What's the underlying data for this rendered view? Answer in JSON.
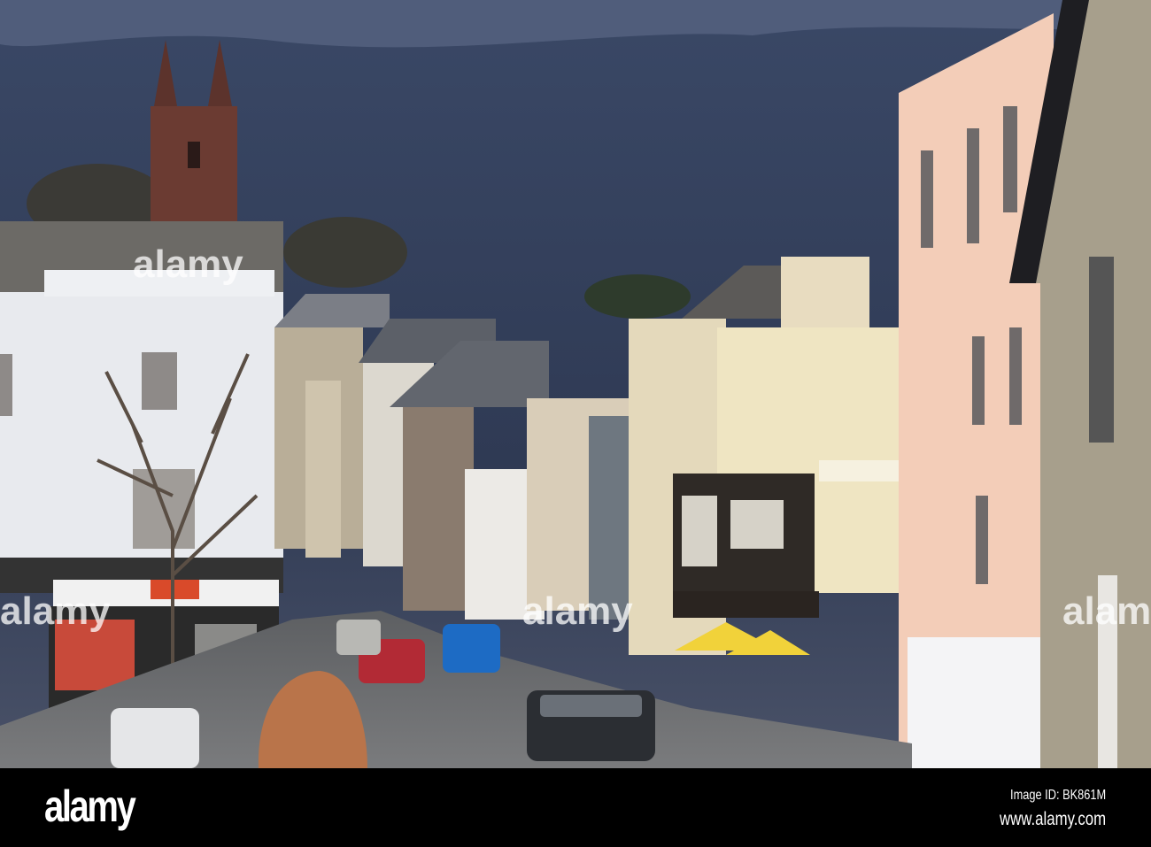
{
  "photo": {
    "subject": "Town high street with shops, cars and church tower under stormy sky"
  },
  "watermark": {
    "text": "alamy"
  },
  "footer": {
    "logo": "alamy",
    "image_id": "Image ID: BK861M",
    "website": "www.alamy.com"
  },
  "colors": {
    "sky": "#3a4a68",
    "footer": "#000000"
  }
}
